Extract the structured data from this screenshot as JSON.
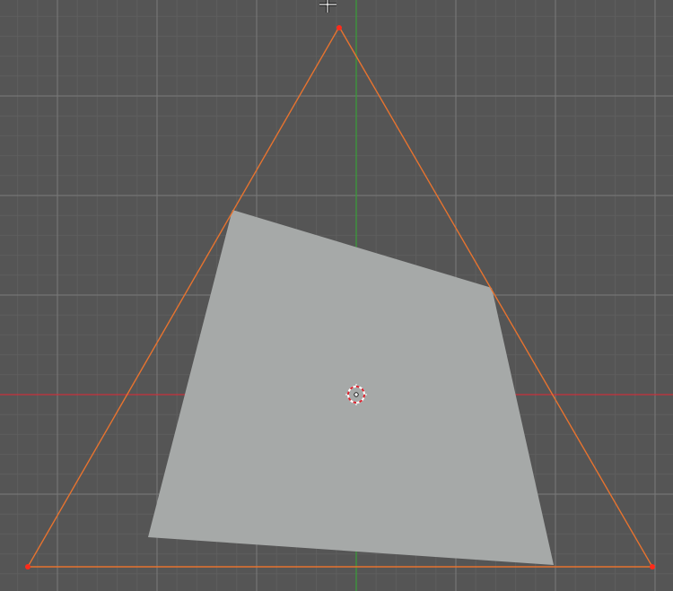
{
  "viewport": {
    "background": "#555555",
    "grid_minor_color": "#5e5e5e",
    "grid_major_color": "#7a7a7a"
  },
  "axes": {
    "x_axis_color": "#c8313c",
    "y_axis_color": "#3a9a3a"
  },
  "triangle": {
    "edge_color": "#e7732f",
    "vertex_color": "#ff2a1a"
  },
  "face": {
    "fill": "#a6a9a8"
  },
  "cursor_3d": {
    "ring_colors": [
      "#d9232e",
      "#ffffff"
    ],
    "center_color": "#1a1a1a",
    "icon": "3d-cursor-icon"
  },
  "mouse_cursor": {
    "icon": "crosshair-cursor-icon"
  }
}
